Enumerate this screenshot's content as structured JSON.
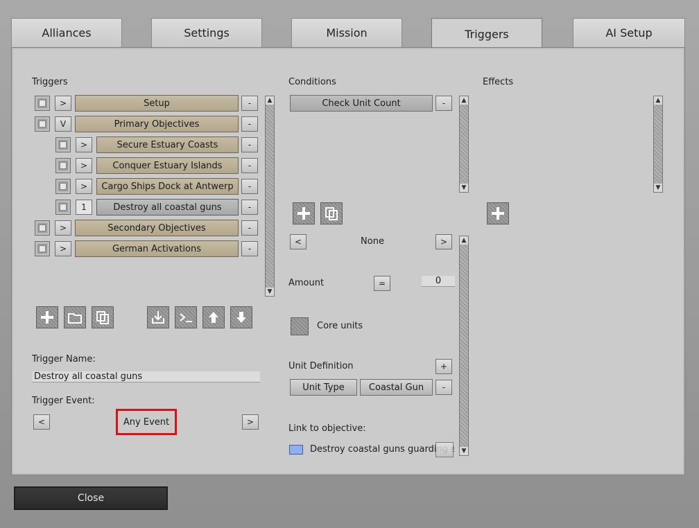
{
  "tabs": [
    "Alliances",
    "Settings",
    "Mission",
    "Triggers",
    "AI Setup"
  ],
  "triggers": {
    "label": "Triggers",
    "items": [
      {
        "expander": ">",
        "label": "Setup",
        "indent": 0
      },
      {
        "expander": "V",
        "label": "Primary Objectives",
        "indent": 0
      },
      {
        "expander": ">",
        "label": "Secure Estuary Coasts",
        "indent": 1
      },
      {
        "expander": ">",
        "label": "Conquer Estuary Islands",
        "indent": 1
      },
      {
        "expander": ">",
        "label": "Cargo Ships Dock at Antwerp",
        "indent": 1
      },
      {
        "expander": "1",
        "label": "Destroy all coastal guns",
        "indent": 1,
        "selected": true
      },
      {
        "expander": ">",
        "label": "Secondary Objectives",
        "indent": 0
      },
      {
        "expander": ">",
        "label": "German Activations",
        "indent": 0
      }
    ],
    "remove_label": "-"
  },
  "trigger_name": {
    "label": "Trigger Name:",
    "value": "Destroy all coastal guns"
  },
  "trigger_event": {
    "label": "Trigger Event:",
    "value": "Any Event",
    "prev": "<",
    "next": ">"
  },
  "conditions": {
    "label": "Conditions",
    "items": [
      "Check Unit Count"
    ],
    "selector": {
      "prev": "<",
      "value": "None",
      "next": ">"
    },
    "amount": {
      "label": "Amount",
      "operator": "=",
      "value": "0"
    },
    "core_units": "Core units",
    "unit_definition": {
      "label": "Unit Definition",
      "add": "+",
      "type_label": "Unit Type",
      "type_value": "Coastal Gun",
      "remove": "-"
    },
    "link_objective": {
      "label": "Link to objective:",
      "value": "Destroy coastal guns guarding estu"
    }
  },
  "effects": {
    "label": "Effects"
  },
  "close_label": "Close",
  "colors": {
    "highlight_border": "#e01010",
    "objective_swatch": "#8fb0f0"
  }
}
